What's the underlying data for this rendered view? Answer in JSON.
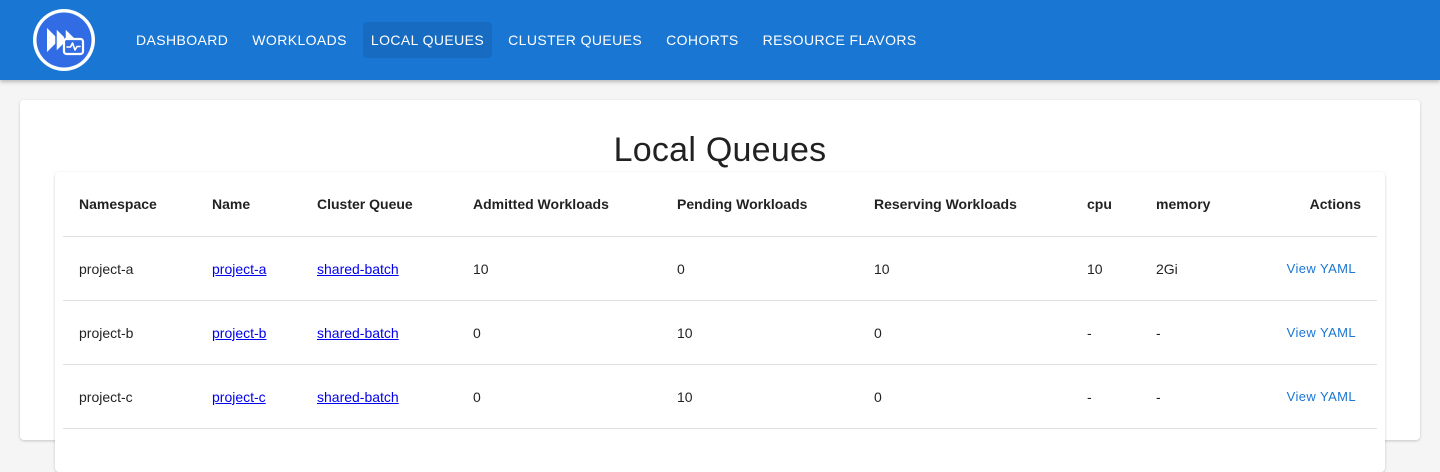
{
  "nav": {
    "items": [
      {
        "label": "DASHBOARD",
        "active": false
      },
      {
        "label": "WORKLOADS",
        "active": false
      },
      {
        "label": "LOCAL QUEUES",
        "active": true
      },
      {
        "label": "CLUSTER QUEUES",
        "active": false
      },
      {
        "label": "COHORTS",
        "active": false
      },
      {
        "label": "RESOURCE FLAVORS",
        "active": false
      }
    ]
  },
  "page": {
    "title": "Local Queues"
  },
  "table": {
    "headers": {
      "namespace": "Namespace",
      "name": "Name",
      "cluster_queue": "Cluster Queue",
      "admitted": "Admitted Workloads",
      "pending": "Pending Workloads",
      "reserving": "Reserving Workloads",
      "cpu": "cpu",
      "memory": "memory",
      "actions": "Actions"
    },
    "rows": [
      {
        "namespace": "project-a",
        "name": "project-a",
        "cluster_queue": "shared-batch",
        "admitted": "10",
        "pending": "0",
        "reserving": "10",
        "cpu": "10",
        "memory": "2Gi",
        "action": "View YAML"
      },
      {
        "namespace": "project-b",
        "name": "project-b",
        "cluster_queue": "shared-batch",
        "admitted": "0",
        "pending": "10",
        "reserving": "0",
        "cpu": "-",
        "memory": "-",
        "action": "View YAML"
      },
      {
        "namespace": "project-c",
        "name": "project-c",
        "cluster_queue": "shared-batch",
        "admitted": "0",
        "pending": "10",
        "reserving": "0",
        "cpu": "-",
        "memory": "-",
        "action": "View YAML"
      }
    ]
  },
  "colors": {
    "appbar": "#1976d2",
    "link": "#0000ee",
    "action": "#1976d2"
  }
}
